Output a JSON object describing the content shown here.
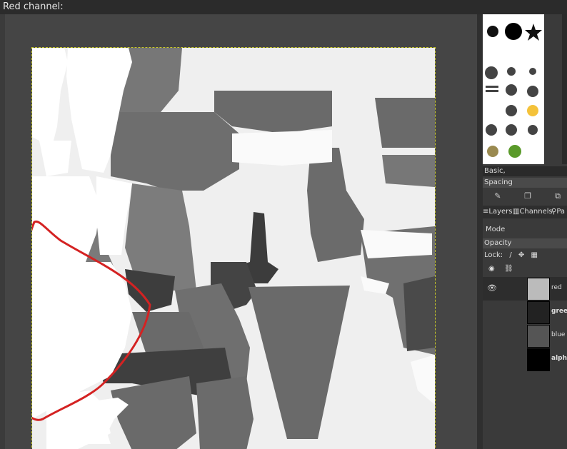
{
  "window": {
    "title": "Red channel:"
  },
  "brushes": {
    "preset_label": "Basic,",
    "spacing_label": "Spacing",
    "icons": [
      "edit-brush-icon",
      "new-brush-icon",
      "duplicate-brush-icon"
    ]
  },
  "tabs": [
    {
      "label": "Layers",
      "icon": "layers-icon"
    },
    {
      "label": "Channels",
      "icon": "channels-icon"
    },
    {
      "label": "Pa",
      "icon": "paths-icon"
    }
  ],
  "layers_panel": {
    "mode_label": "Mode",
    "opacity_label": "Opacity",
    "lock_label": "Lock:",
    "channels": [
      {
        "name": "red",
        "visible": true,
        "selected": true
      },
      {
        "name": "gree",
        "visible": false,
        "selected": false
      },
      {
        "name": "blue",
        "visible": false,
        "selected": false
      },
      {
        "name": "alpha",
        "visible": false,
        "selected": false
      }
    ]
  },
  "colors": {
    "annotation": "#d42222",
    "selection_border": "#c9c92b",
    "panel_bg": "#3a3a3a"
  }
}
